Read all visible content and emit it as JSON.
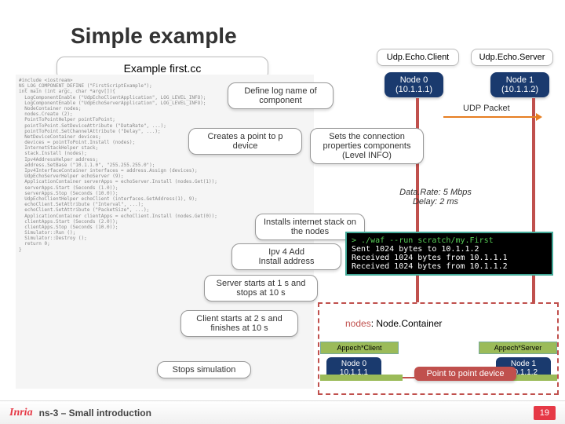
{
  "title": "Simple example",
  "subtitle": "Example first.cc",
  "labels": {
    "udp_client": "Udp.Echo.Client",
    "udp_server": "Udp.Echo.Server",
    "udp_packet": "UDP Packet"
  },
  "nodes": {
    "n0_top": "Node 0\n(10.1.1.1)",
    "n1_top": "Node 1\n(10.1.1.2)",
    "n0_bot": "Node 0\n10.1.1.1",
    "n1_bot": "Node 1\n10.1.1.2"
  },
  "callouts": {
    "deflog": "Define log name of component",
    "creates": "Creates a point to p     device",
    "setconn": "Sets the connection properties components (Level INFO)",
    "datarate": "Data.Rate: 5 Mbps\nDelay: 2 ms",
    "installs_stack": "Installs internet stack on the nodes",
    "ipv4": "Ipv 4 Add\n    Install address",
    "server": "Server starts at 1 s and stops at 10 s",
    "client": "Client starts at 2 s and finishes at 10 s",
    "stops": "Stops simulation"
  },
  "terminal": {
    "cmd": "> ./waf --run scratch/my.First",
    "l1": "Sent 1024 bytes to 10.1.1.2",
    "l2": "Received 1024 bytes from 10.1.1.1",
    "l3": "Received 1024 bytes from 10.1.1.2"
  },
  "nodes_container": {
    "a": "nodes",
    "b": ": Node.Container"
  },
  "bottom": {
    "appech_client": "Appech*Client",
    "appech_server": "Appech*Server",
    "ptp": "Point to point device"
  },
  "footer": {
    "logo": "Inria",
    "title": "ns-3 – Small introduction",
    "page": "19"
  },
  "code": "#include <iostream>\nNS_LOG_COMPONENT_DEFINE (\"FirstScriptExample\");\nint main (int argc, char *argv[]){\n  LogComponentEnable (\"UdpEchoClientApplication\", LOG_LEVEL_INFO);\n  LogComponentEnable (\"UdpEchoServerApplication\", LOG_LEVEL_INFO);\n  NodeContainer nodes;\n  nodes.Create (2);\n  PointToPointHelper pointToPoint;\n  pointToPoint.SetDeviceAttribute (\"DataRate\", ...);\n  pointToPoint.SetChannelAttribute (\"Delay\", ...);\n  NetDeviceContainer devices;\n  devices = pointToPoint.Install (nodes);\n  InternetStackHelper stack;\n  stack.Install (nodes);\n  Ipv4AddressHelper address;\n  address.SetBase (\"10.1.1.0\", \"255.255.255.0\");\n  Ipv4InterfaceContainer interfaces = address.Assign (devices);\n  UdpEchoServerHelper echoServer (9);\n  ApplicationContainer serverApps = echoServer.Install (nodes.Get(1));\n  serverApps.Start (Seconds (1.0));\n  serverApps.Stop (Seconds (10.0));\n  UdpEchoClientHelper echoClient (interfaces.GetAddress(1), 9);\n  echoClient.SetAttribute (\"Interval\", ...);\n  echoClient.SetAttribute (\"PacketSize\", ...);\n  ApplicationContainer clientApps = echoClient.Install (nodes.Get(0));\n  clientApps.Start (Seconds (2.0));\n  clientApps.Stop (Seconds (10.0));\n  Simulator::Run ();\n  Simulator::Destroy ();\n  return 0;\n}"
}
